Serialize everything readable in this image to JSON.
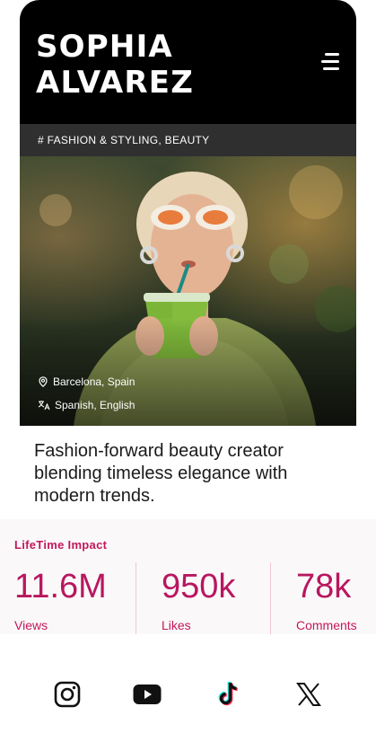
{
  "profile": {
    "name_line1": "SOPHIA",
    "name_line2": "ALVAREZ",
    "tags": "# FASHION & STYLING, BEAUTY",
    "location": "Barcelona, Spain",
    "languages": "Spanish, English",
    "bio": "Fashion-forward beauty creator blending timeless elegance with modern trends."
  },
  "impact": {
    "title": "LifeTime Impact",
    "stats": [
      {
        "value": "11.6M",
        "label": "Views"
      },
      {
        "value": "950k",
        "label": "Likes"
      },
      {
        "value": "78k",
        "label": "Comments"
      }
    ]
  },
  "social": [
    "instagram-icon",
    "youtube-icon",
    "tiktok-icon",
    "x-icon"
  ],
  "colors": {
    "accent": "#c2185b",
    "header_bg": "#000000",
    "tag_bar_bg": "#2f2f2f"
  }
}
